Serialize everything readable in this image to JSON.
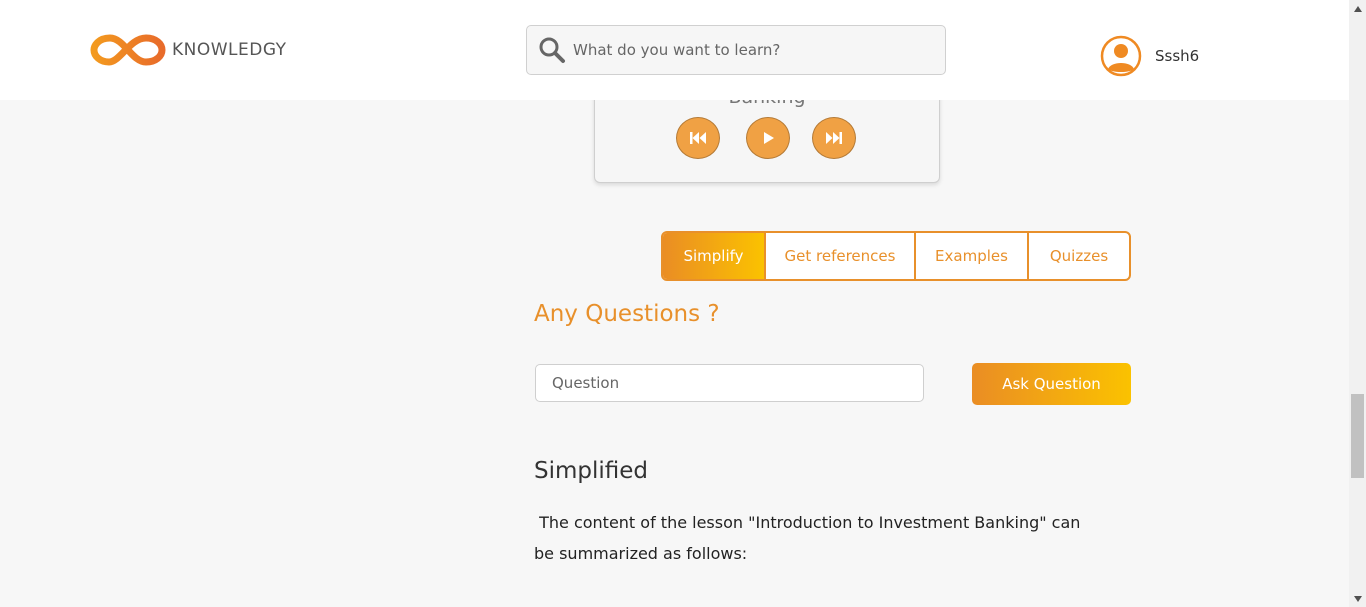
{
  "header": {
    "brand": "KNOWLEDGY",
    "logo_icon": "infinity-logo-icon",
    "search": {
      "placeholder": "What do you want to learn?",
      "value": "",
      "icon": "search-icon"
    },
    "user": {
      "name": "Sssh6",
      "avatar_icon": "user-avatar-icon"
    }
  },
  "player": {
    "title": "Banking",
    "controls": [
      "previous-icon",
      "play-icon",
      "next-icon"
    ]
  },
  "tabs": [
    {
      "label": "Simplify",
      "active": true
    },
    {
      "label": "Get references",
      "active": false
    },
    {
      "label": "Examples",
      "active": false
    },
    {
      "label": "Quizzes",
      "active": false
    }
  ],
  "questions": {
    "heading": "Any Questions ?",
    "input_placeholder": "Question",
    "input_value": "",
    "button_label": "Ask Question"
  },
  "simplified": {
    "heading": "Simplified",
    "body": " The content of the lesson \"Introduction to Investment Banking\" can be summarized as follows:"
  },
  "colors": {
    "accent": "#e8902b",
    "accent_gradient_end": "#fbc200",
    "player_button": "#f0a144",
    "background": "#f7f7f7"
  }
}
